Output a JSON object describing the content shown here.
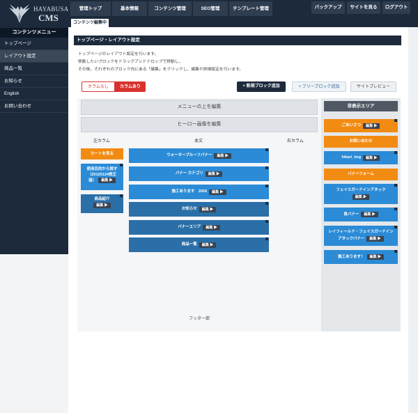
{
  "brand": {
    "line1": "HAYABUSA",
    "line2": "CMS"
  },
  "sidebar": {
    "menu_title": "コンテンツメニュー",
    "items": [
      {
        "label": "トップページ"
      },
      {
        "label": "レイアウト設定"
      },
      {
        "label": "商品一覧"
      },
      {
        "label": "お知らせ"
      },
      {
        "label": "English"
      },
      {
        "label": "お問い合わせ"
      }
    ]
  },
  "topnav": {
    "tabs": [
      {
        "label": "管理トップ"
      },
      {
        "label": "基本情報"
      },
      {
        "label": "コンテンツ管理"
      },
      {
        "label": "SEO管理"
      },
      {
        "label": "テンプレート管理"
      }
    ],
    "right": [
      {
        "label": "バックアップ"
      },
      {
        "label": "サイトを見る"
      },
      {
        "label": "ログアウト"
      }
    ],
    "sub_tab": "コンテンツ編集中"
  },
  "page": {
    "title": "トップページ・レイアウト設定",
    "desc": [
      "トップページのレイアウト設定を行います。",
      "移動したいブロックをドラッグアンドドロップで移動し、",
      "その後、それぞれのブロック内にある「編集」をクリックし、編集や詳細設定を行います。"
    ]
  },
  "toolbar": {
    "column_none": "カラムなし",
    "column_have": "カラムあり",
    "new_block": "+ 新規ブロック追加",
    "free_block": "+ フリーブロック追加",
    "preview": "サイトプレビュー"
  },
  "layout": {
    "above_menu": "メニューの上を編集",
    "hero": "ヒーロー画像を編集",
    "left_column": "左カラム",
    "main_column": "本文",
    "right_column": "右カラム",
    "footer": "フッター部",
    "edit_label": "編集 ▶",
    "left_blocks": [
      {
        "label": "カートを見る"
      },
      {
        "label1": "使用目的から探す",
        "label2": "（20120124修正",
        "label3": "版）"
      },
      {
        "label": "商品紹介"
      }
    ],
    "main_blocks": [
      {
        "label": "ウォータープルーフバナー"
      },
      {
        "label": "バナー カテゴリ"
      },
      {
        "label": "施工あります　2026"
      },
      {
        "label": "お知らせ"
      },
      {
        "label": "バナーエリア"
      },
      {
        "label": "商品一覧"
      }
    ]
  },
  "hidden": {
    "title": "非表示エリア",
    "blocks": [
      {
        "label": "ごあいさつ"
      },
      {
        "label": "お問い合わせ"
      },
      {
        "label": "hikari_img"
      },
      {
        "label": "バナーフォーム"
      },
      {
        "label": "フェイスガードインアタック"
      },
      {
        "label": "長バナー"
      },
      {
        "label1": "レイフィールド・フェイスガードイン",
        "label2": "アタックバナー"
      },
      {
        "label": "施工あります！"
      }
    ]
  },
  "colors": {
    "navy": "#1c2a3c",
    "blue": "#2b8bd6",
    "dark_blue": "#2a6fa8",
    "orange": "#f28b12",
    "red": "#d8322e"
  }
}
